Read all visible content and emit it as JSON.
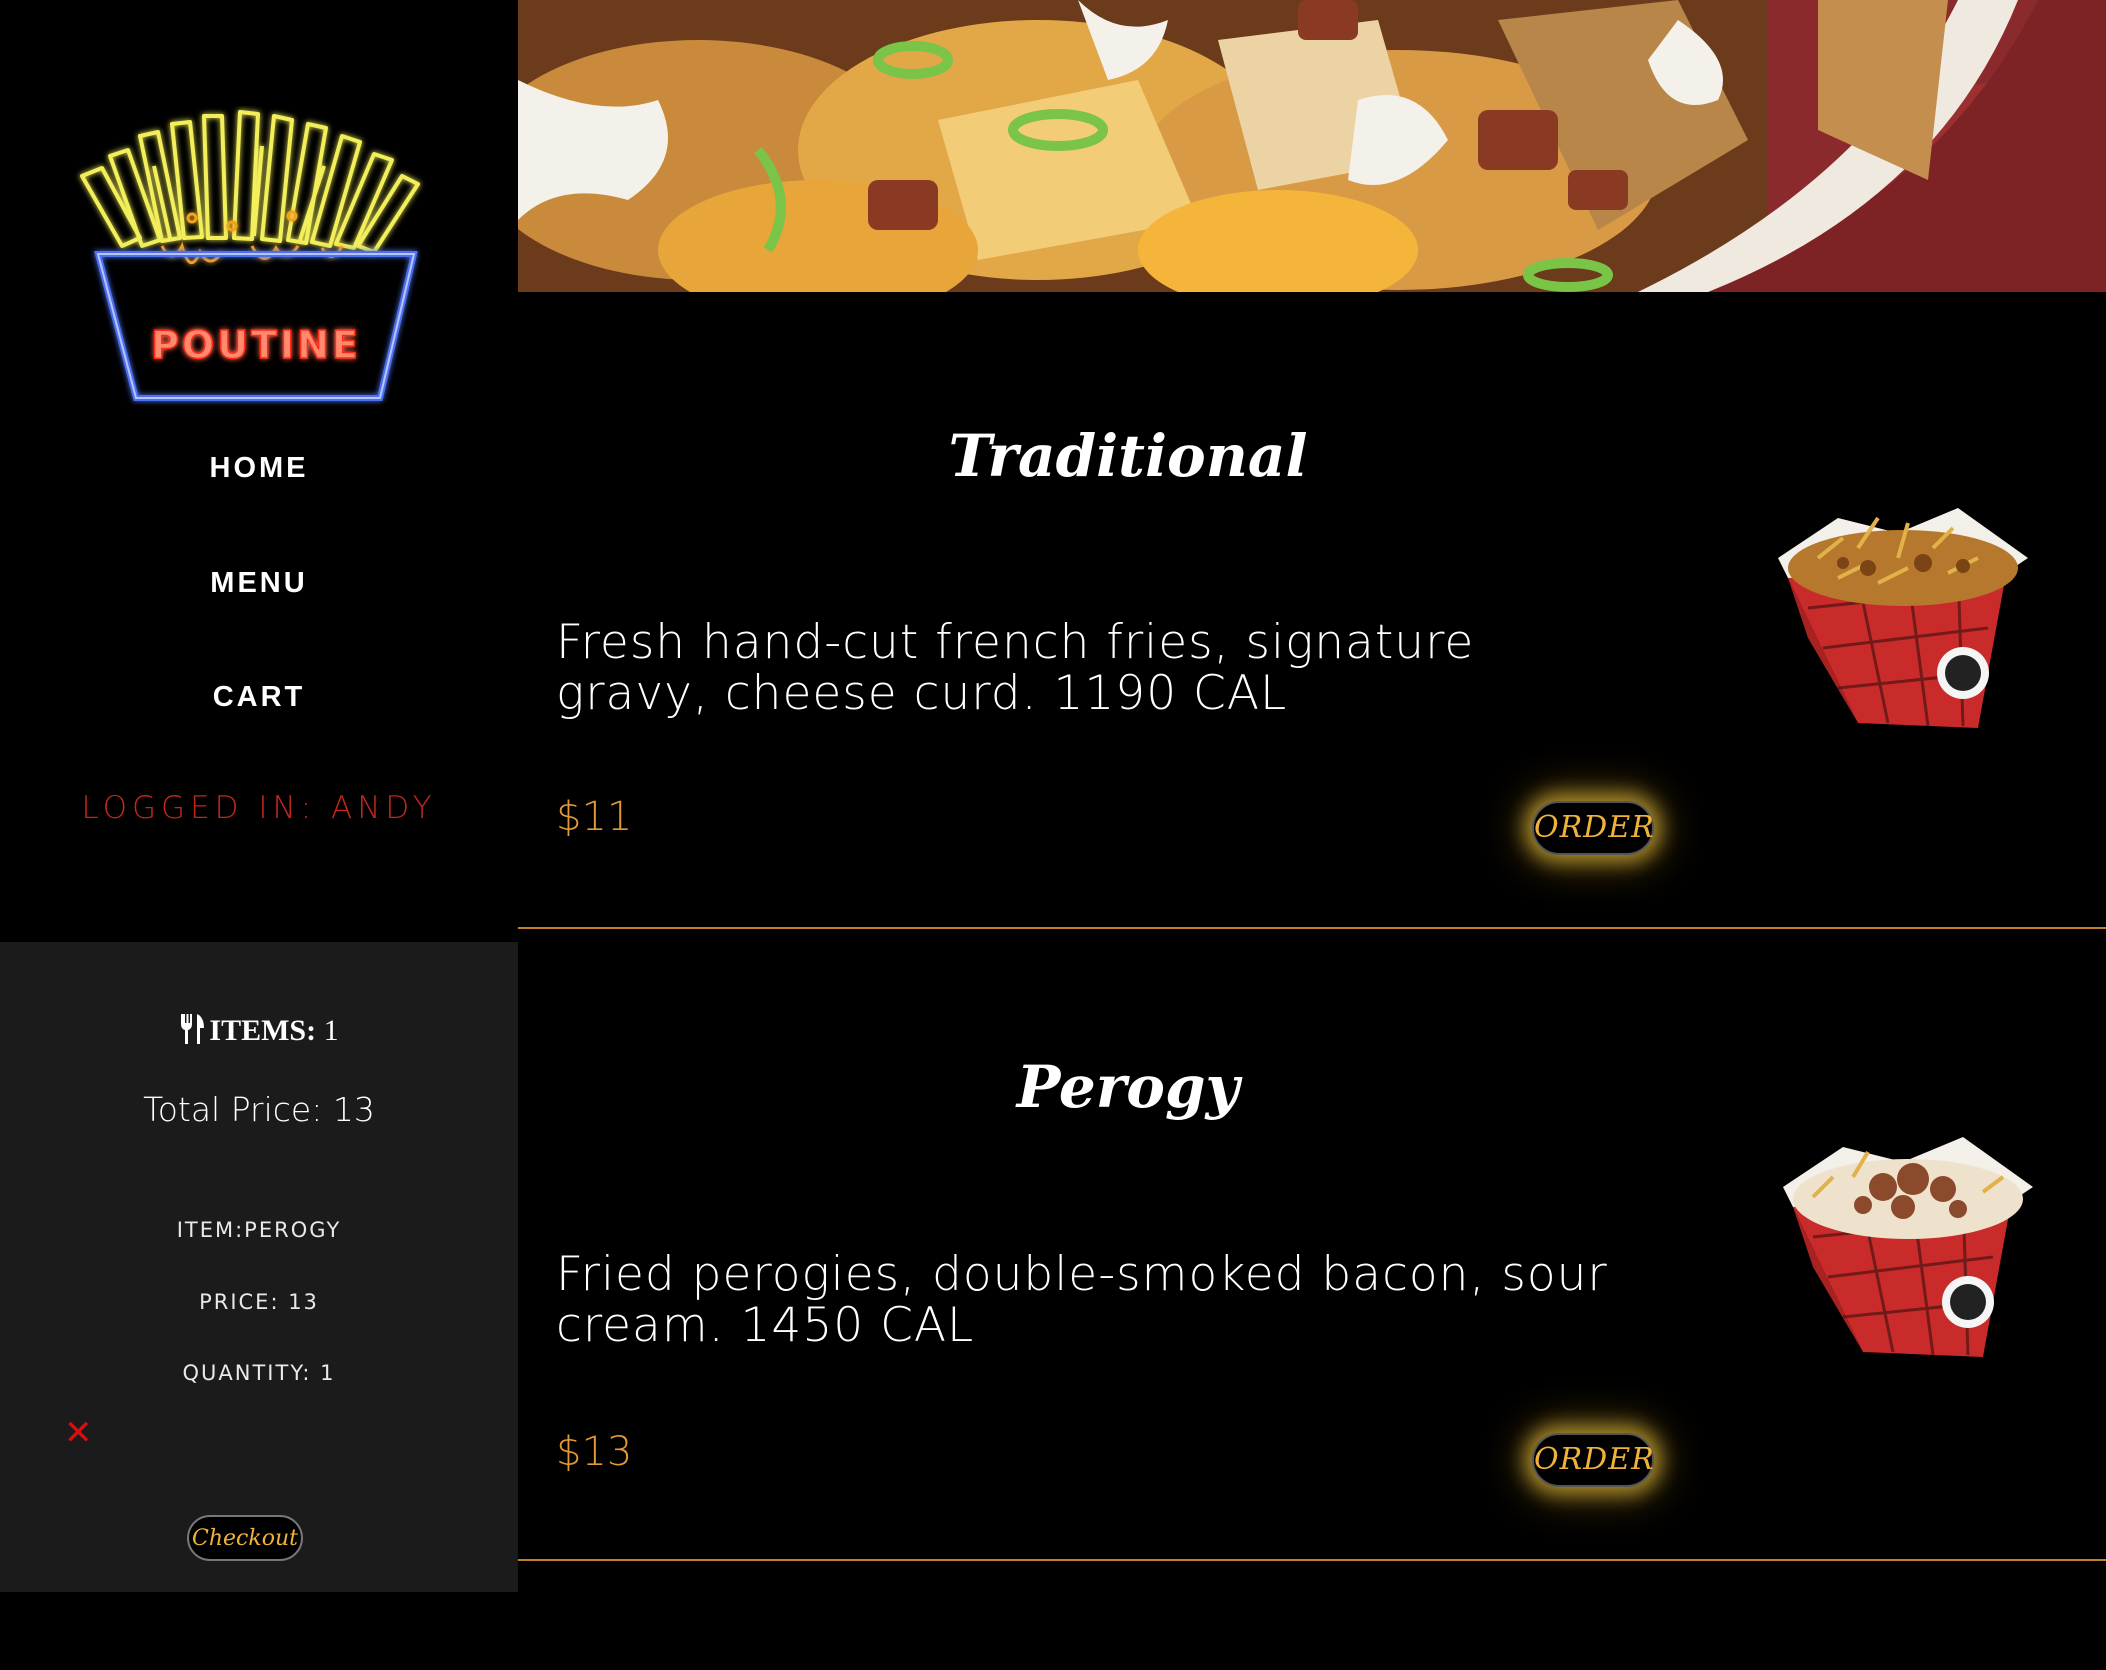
{
  "logo": {
    "text": "POUTINE"
  },
  "nav": [
    {
      "label": "HOME"
    },
    {
      "label": "MENU"
    },
    {
      "label": "CART"
    }
  ],
  "user": {
    "logged_in_text": "LOGGED IN: ANDY"
  },
  "cart": {
    "items_label": "ITEMS:",
    "items_count": "1",
    "total_text": "Total Price: 13",
    "item_name_text": "ITEM:PEROGY",
    "item_price_text": "PRICE: 13",
    "item_quantity_text": "QUANTITY: 1",
    "remove_symbol": "✕",
    "checkout_label": "Checkout"
  },
  "menu": [
    {
      "title": "Traditional",
      "description": "Fresh hand-cut french fries, signature gravy, cheese curd. 1190 CAL",
      "price": "$11",
      "order_label": "ORDER"
    },
    {
      "title": "Perogy",
      "description": "Fried perogies, double-smoked bacon, sour cream. 1450 CAL",
      "price": "$13",
      "order_label": "ORDER"
    }
  ],
  "colors": {
    "background": "#000000",
    "cart_panel": "#1b1b1c",
    "price_accent": "#e39a33",
    "order_text": "#f0b33a",
    "logged_in": "#c4261d",
    "divider": "#c47f2a"
  }
}
